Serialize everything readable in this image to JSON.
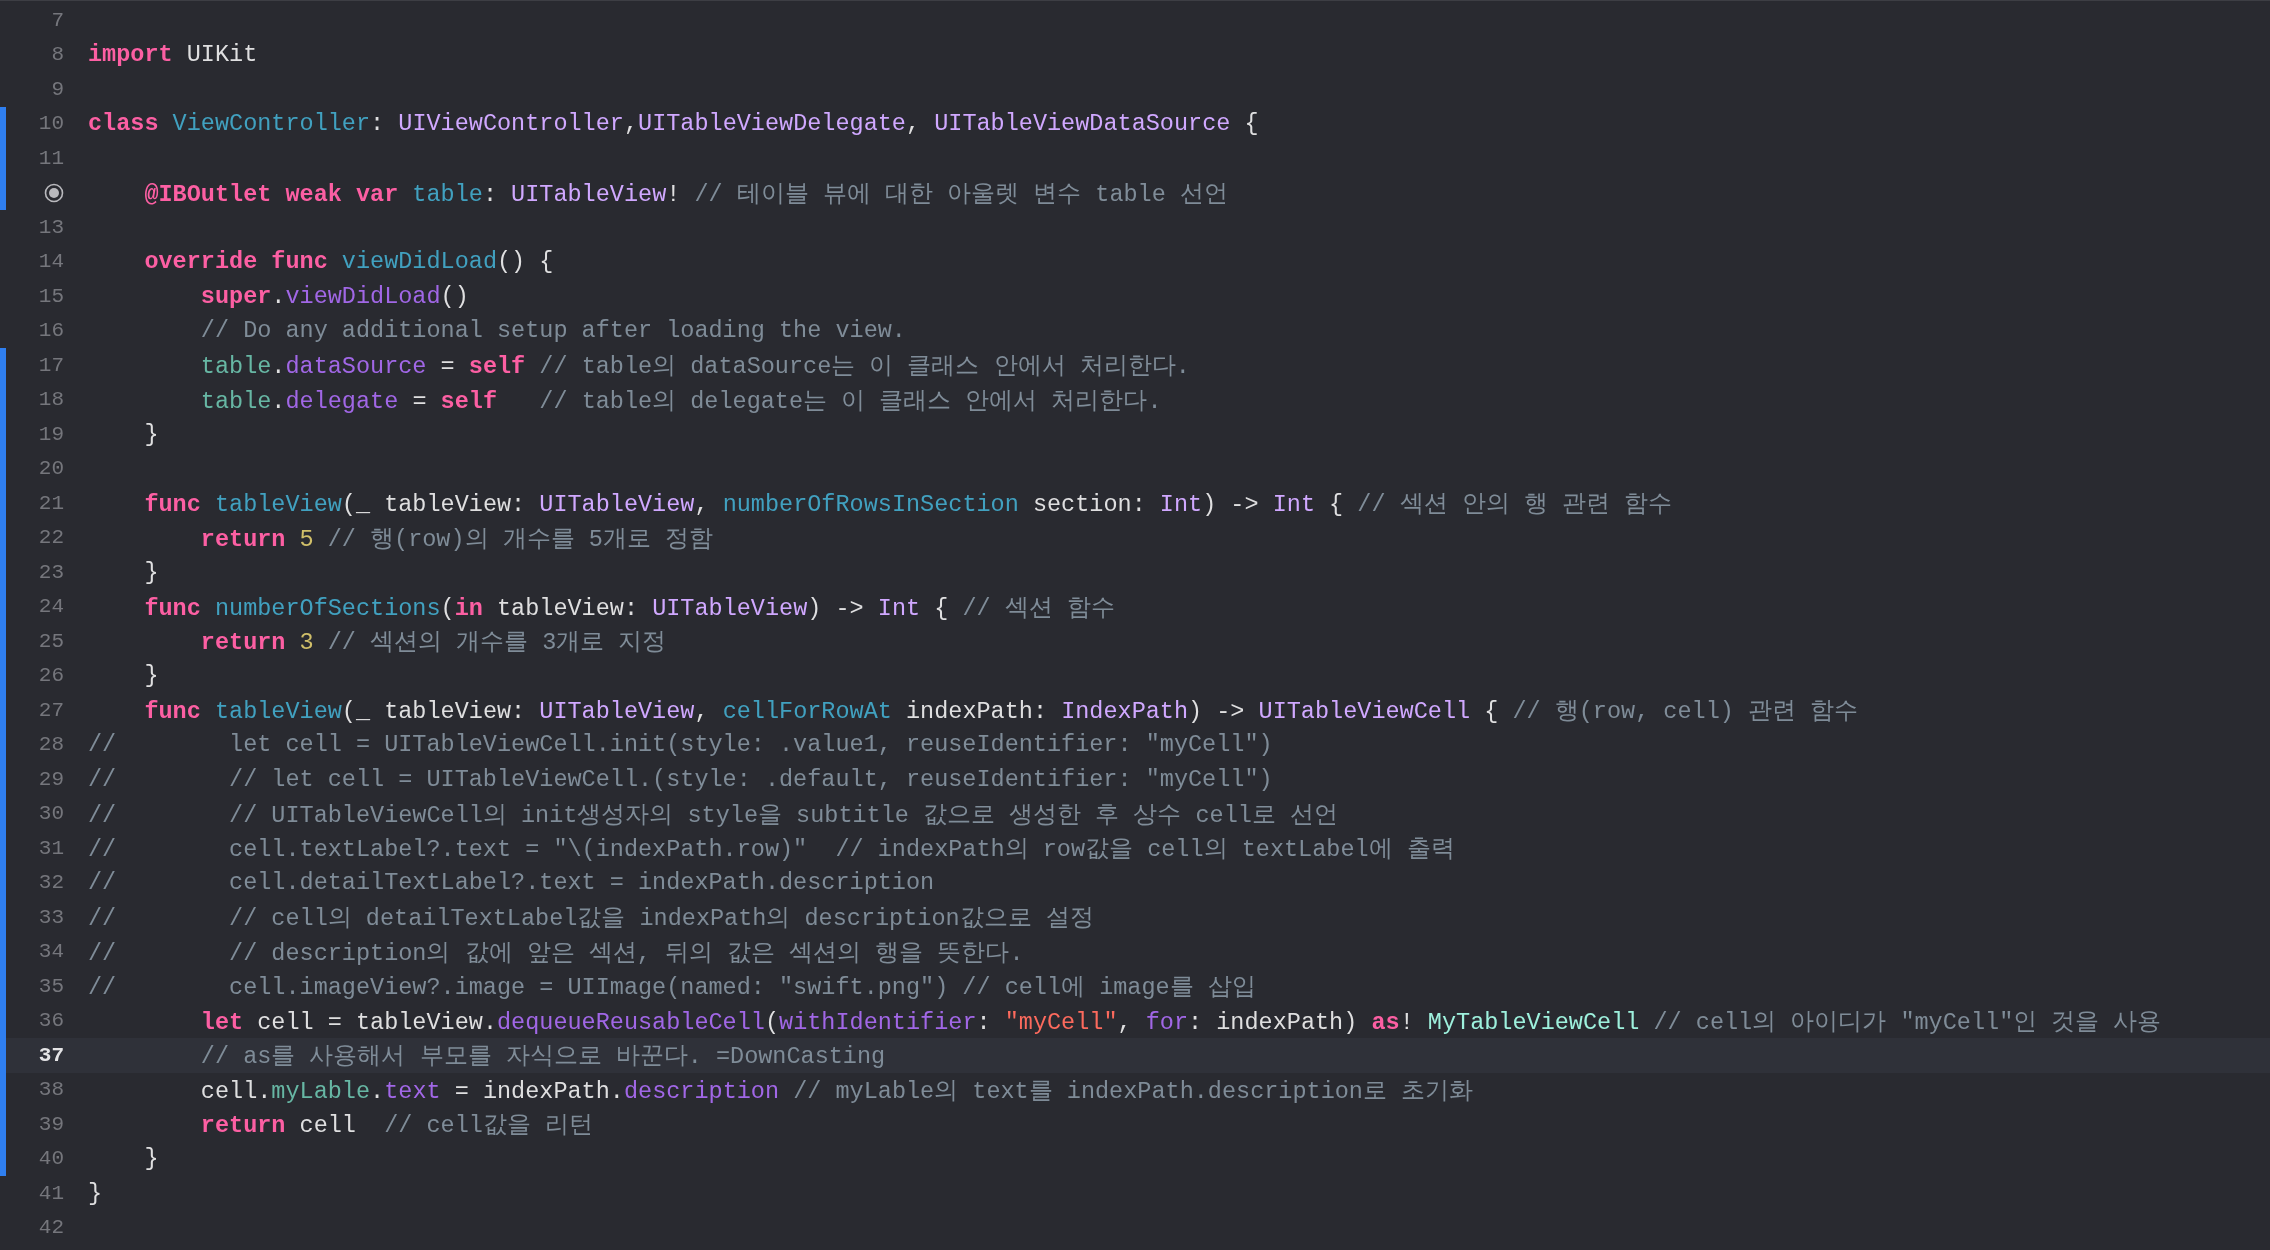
{
  "editor": {
    "lines": [
      {
        "kind": "numbered",
        "number": "7",
        "changed": false,
        "current": false
      },
      {
        "kind": "numbered",
        "number": "8",
        "changed": false,
        "current": false,
        "tokens": [
          {
            "kind": "keyword",
            "text": "import"
          },
          {
            "kind": "plain",
            "text": " UIKit"
          }
        ]
      },
      {
        "kind": "numbered",
        "number": "9",
        "changed": false,
        "current": false
      },
      {
        "kind": "numbered",
        "number": "10",
        "changed": true,
        "current": false,
        "tokens": [
          {
            "kind": "keyword",
            "text": "class"
          },
          {
            "kind": "decl",
            "text": " ViewController"
          },
          {
            "kind": "plain",
            "text": ": "
          },
          {
            "kind": "type",
            "text": "UIViewController"
          },
          {
            "kind": "plain",
            "text": ","
          },
          {
            "kind": "type",
            "text": "UITableViewDelegate"
          },
          {
            "kind": "plain",
            "text": ", "
          },
          {
            "kind": "type",
            "text": "UITableViewDataSource"
          },
          {
            "kind": "plain",
            "text": " {"
          }
        ]
      },
      {
        "kind": "numbered",
        "number": "11",
        "changed": true,
        "current": false
      },
      {
        "kind": "outlet",
        "changed": true,
        "current": false,
        "tokens": [
          {
            "kind": "keyword",
            "text": "    @IBOutlet weak var"
          },
          {
            "kind": "decl",
            "text": " table"
          },
          {
            "kind": "plain",
            "text": ": "
          },
          {
            "kind": "type",
            "text": "UITableView"
          },
          {
            "kind": "plain",
            "text": "! "
          },
          {
            "kind": "comment",
            "text": "// 테이블 뷰에 대한 아울렛 변수 table 선언"
          }
        ]
      },
      {
        "kind": "numbered",
        "number": "13",
        "changed": false,
        "current": false
      },
      {
        "kind": "numbered",
        "number": "14",
        "changed": false,
        "current": false,
        "tokens": [
          {
            "kind": "keyword",
            "text": "    override func"
          },
          {
            "kind": "decl",
            "text": " viewDidLoad"
          },
          {
            "kind": "plain",
            "text": "() {"
          }
        ]
      },
      {
        "kind": "numbered",
        "number": "15",
        "changed": false,
        "current": false,
        "tokens": [
          {
            "kind": "keyword",
            "text": "        super"
          },
          {
            "kind": "plain",
            "text": "."
          },
          {
            "kind": "method",
            "text": "viewDidLoad"
          },
          {
            "kind": "plain",
            "text": "()"
          }
        ]
      },
      {
        "kind": "numbered",
        "number": "16",
        "changed": false,
        "current": false,
        "tokens": [
          {
            "kind": "comment",
            "text": "        // Do any additional setup after loading the view."
          }
        ]
      },
      {
        "kind": "numbered",
        "number": "17",
        "changed": true,
        "current": false,
        "tokens": [
          {
            "kind": "prop",
            "text": "        table"
          },
          {
            "kind": "plain",
            "text": "."
          },
          {
            "kind": "method",
            "text": "dataSource"
          },
          {
            "kind": "plain",
            "text": " = "
          },
          {
            "kind": "keyword",
            "text": "self"
          },
          {
            "kind": "comment",
            "text": " // table의 dataSource는 이 클래스 안에서 처리한다."
          }
        ]
      },
      {
        "kind": "numbered",
        "number": "18",
        "changed": true,
        "current": false,
        "tokens": [
          {
            "kind": "prop",
            "text": "        table"
          },
          {
            "kind": "plain",
            "text": "."
          },
          {
            "kind": "method",
            "text": "delegate"
          },
          {
            "kind": "plain",
            "text": " = "
          },
          {
            "kind": "keyword",
            "text": "self"
          },
          {
            "kind": "comment",
            "text": "   // table의 delegate는 이 클래스 안에서 처리한다."
          }
        ]
      },
      {
        "kind": "numbered",
        "number": "19",
        "changed": true,
        "current": false,
        "tokens": [
          {
            "kind": "plain",
            "text": "    }"
          }
        ]
      },
      {
        "kind": "numbered",
        "number": "20",
        "changed": true,
        "current": false
      },
      {
        "kind": "numbered",
        "number": "21",
        "changed": true,
        "current": false,
        "tokens": [
          {
            "kind": "keyword",
            "text": "    func"
          },
          {
            "kind": "decl",
            "text": " tableView"
          },
          {
            "kind": "plain",
            "text": "(_ tableView: "
          },
          {
            "kind": "type",
            "text": "UITableView"
          },
          {
            "kind": "plain",
            "text": ", "
          },
          {
            "kind": "decl",
            "text": "numberOfRowsInSection"
          },
          {
            "kind": "plain",
            "text": " section: "
          },
          {
            "kind": "type",
            "text": "Int"
          },
          {
            "kind": "plain",
            "text": ") -> "
          },
          {
            "kind": "type",
            "text": "Int"
          },
          {
            "kind": "plain",
            "text": " { "
          },
          {
            "kind": "comment",
            "text": "// 섹션 안의 행 관련 함수"
          }
        ]
      },
      {
        "kind": "numbered",
        "number": "22",
        "changed": true,
        "current": false,
        "tokens": [
          {
            "kind": "keyword",
            "text": "        return"
          },
          {
            "kind": "number",
            "text": " 5"
          },
          {
            "kind": "comment",
            "text": " // 행(row)의 개수를 5개로 정함"
          }
        ]
      },
      {
        "kind": "numbered",
        "number": "23",
        "changed": true,
        "current": false,
        "tokens": [
          {
            "kind": "plain",
            "text": "    }"
          }
        ]
      },
      {
        "kind": "numbered",
        "number": "24",
        "changed": true,
        "current": false,
        "tokens": [
          {
            "kind": "keyword",
            "text": "    func"
          },
          {
            "kind": "decl",
            "text": " numberOfSections"
          },
          {
            "kind": "plain",
            "text": "("
          },
          {
            "kind": "keyword",
            "text": "in"
          },
          {
            "kind": "plain",
            "text": " tableView: "
          },
          {
            "kind": "type",
            "text": "UITableView"
          },
          {
            "kind": "plain",
            "text": ") -> "
          },
          {
            "kind": "type",
            "text": "Int"
          },
          {
            "kind": "plain",
            "text": " { "
          },
          {
            "kind": "comment",
            "text": "// 섹션 함수"
          }
        ]
      },
      {
        "kind": "numbered",
        "number": "25",
        "changed": true,
        "current": false,
        "tokens": [
          {
            "kind": "keyword",
            "text": "        return"
          },
          {
            "kind": "number",
            "text": " 3"
          },
          {
            "kind": "comment",
            "text": " // 섹션의 개수를 3개로 지정"
          }
        ]
      },
      {
        "kind": "numbered",
        "number": "26",
        "changed": true,
        "current": false,
        "tokens": [
          {
            "kind": "plain",
            "text": "    }"
          }
        ]
      },
      {
        "kind": "numbered",
        "number": "27",
        "changed": true,
        "current": false,
        "tokens": [
          {
            "kind": "keyword",
            "text": "    func"
          },
          {
            "kind": "decl",
            "text": " tableView"
          },
          {
            "kind": "plain",
            "text": "(_ tableView: "
          },
          {
            "kind": "type",
            "text": "UITableView"
          },
          {
            "kind": "plain",
            "text": ", "
          },
          {
            "kind": "decl",
            "text": "cellForRowAt"
          },
          {
            "kind": "plain",
            "text": " indexPath: "
          },
          {
            "kind": "type",
            "text": "IndexPath"
          },
          {
            "kind": "plain",
            "text": ") -> "
          },
          {
            "kind": "type",
            "text": "UITableViewCell"
          },
          {
            "kind": "plain",
            "text": " { "
          },
          {
            "kind": "comment",
            "text": "// 행(row, cell) 관련 함수"
          }
        ]
      },
      {
        "kind": "numbered",
        "number": "28",
        "changed": true,
        "current": false,
        "tokens": [
          {
            "kind": "comment",
            "text": "//        let cell = UITableViewCell.init(style: .value1, reuseIdentifier: \"myCell\")"
          }
        ]
      },
      {
        "kind": "numbered",
        "number": "29",
        "changed": true,
        "current": false,
        "tokens": [
          {
            "kind": "comment",
            "text": "//        // let cell = UITableViewCell.(style: .default, reuseIdentifier: \"myCell\")"
          }
        ]
      },
      {
        "kind": "numbered",
        "number": "30",
        "changed": true,
        "current": false,
        "tokens": [
          {
            "kind": "comment",
            "text": "//        // UITableViewCell의 init생성자의 style을 subtitle 값으로 생성한 후 상수 cell로 선언"
          }
        ]
      },
      {
        "kind": "numbered",
        "number": "31",
        "changed": true,
        "current": false,
        "tokens": [
          {
            "kind": "comment",
            "text": "//        cell.textLabel?.text = \"\\(indexPath.row)\"  // indexPath의 row값을 cell의 textLabel에 출력"
          }
        ]
      },
      {
        "kind": "numbered",
        "number": "32",
        "changed": true,
        "current": false,
        "tokens": [
          {
            "kind": "comment",
            "text": "//        cell.detailTextLabel?.text = indexPath.description"
          }
        ]
      },
      {
        "kind": "numbered",
        "number": "33",
        "changed": true,
        "current": false,
        "tokens": [
          {
            "kind": "comment",
            "text": "//        // cell의 detailTextLabel값을 indexPath의 description값으로 설정"
          }
        ]
      },
      {
        "kind": "numbered",
        "number": "34",
        "changed": true,
        "current": false,
        "tokens": [
          {
            "kind": "comment",
            "text": "//        // description의 값에 앞은 섹션, 뒤의 값은 섹션의 행을 뜻한다."
          }
        ]
      },
      {
        "kind": "numbered",
        "number": "35",
        "changed": true,
        "current": false,
        "tokens": [
          {
            "kind": "comment",
            "text": "//        cell.imageView?.image = UIImage(named: \"swift.png\") // cell에 image를 삽입"
          }
        ]
      },
      {
        "kind": "numbered",
        "number": "36",
        "changed": true,
        "current": false,
        "tokens": [
          {
            "kind": "keyword",
            "text": "        let"
          },
          {
            "kind": "plain",
            "text": " cell = tableView."
          },
          {
            "kind": "method",
            "text": "dequeueReusableCell"
          },
          {
            "kind": "plain",
            "text": "("
          },
          {
            "kind": "method",
            "text": "withIdentifier"
          },
          {
            "kind": "plain",
            "text": ": "
          },
          {
            "kind": "string",
            "text": "\"myCell\""
          },
          {
            "kind": "plain",
            "text": ", "
          },
          {
            "kind": "method",
            "text": "for"
          },
          {
            "kind": "plain",
            "text": ": indexPath) "
          },
          {
            "kind": "keyword",
            "text": "as"
          },
          {
            "kind": "plain",
            "text": "! "
          },
          {
            "kind": "projtype",
            "text": "MyTableViewCell"
          },
          {
            "kind": "comment",
            "text": " // cell의 아이디가 \"myCell\"인 것을 사용"
          }
        ]
      },
      {
        "kind": "numbered",
        "number": "37",
        "changed": true,
        "current": true,
        "tokens": [
          {
            "kind": "comment",
            "text": "        // as를 사용해서 부모를 자식으로 바꾼다. =DownCasting"
          }
        ]
      },
      {
        "kind": "numbered",
        "number": "38",
        "changed": true,
        "current": false,
        "tokens": [
          {
            "kind": "plain",
            "text": "        cell."
          },
          {
            "kind": "prop",
            "text": "myLable"
          },
          {
            "kind": "plain",
            "text": "."
          },
          {
            "kind": "method",
            "text": "text"
          },
          {
            "kind": "plain",
            "text": " = indexPath."
          },
          {
            "kind": "method",
            "text": "description"
          },
          {
            "kind": "comment",
            "text": " // myLable의 text를 indexPath.description로 초기화"
          }
        ]
      },
      {
        "kind": "numbered",
        "number": "39",
        "changed": true,
        "current": false,
        "tokens": [
          {
            "kind": "keyword",
            "text": "        return"
          },
          {
            "kind": "plain",
            "text": " cell  "
          },
          {
            "kind": "comment",
            "text": "// cell값을 리턴"
          }
        ]
      },
      {
        "kind": "numbered",
        "number": "40",
        "changed": true,
        "current": false,
        "tokens": [
          {
            "kind": "plain",
            "text": "    }"
          }
        ]
      },
      {
        "kind": "numbered",
        "number": "41",
        "changed": false,
        "current": false,
        "tokens": [
          {
            "kind": "plain",
            "text": "}"
          }
        ]
      },
      {
        "kind": "numbered",
        "number": "42",
        "changed": false,
        "current": false
      }
    ]
  }
}
